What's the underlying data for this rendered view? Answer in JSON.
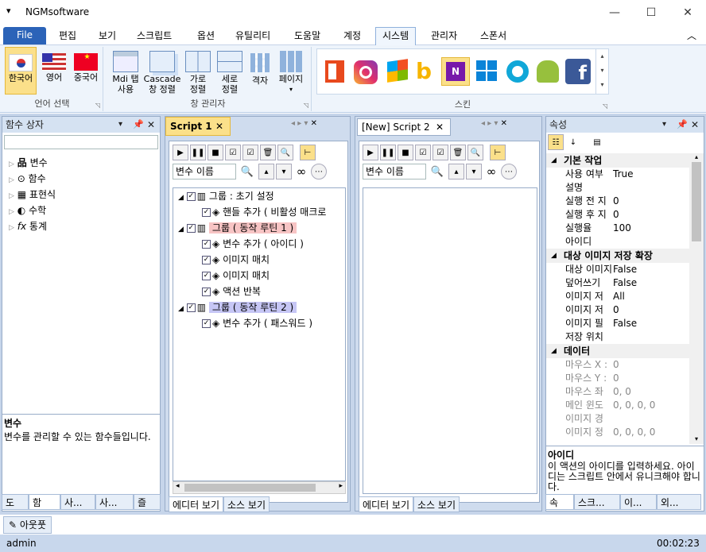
{
  "window": {
    "title": "NGMsoftware"
  },
  "menu": {
    "items": [
      "File",
      "편집",
      "보기",
      "스크립트",
      "옵션",
      "유틸리티",
      "도움말",
      "계정",
      "시스템",
      "관리자",
      "스폰서"
    ]
  },
  "ribbon": {
    "lang_group": {
      "title": "언어 선택",
      "buttons": [
        "한국어",
        "영어",
        "중국어"
      ]
    },
    "window_group": {
      "title": "창 관리자",
      "buttons": [
        [
          "Mdi 탭",
          "사용"
        ],
        [
          "Cascade",
          "창 정렬"
        ],
        [
          "가로",
          "정렬"
        ],
        [
          "세로",
          "정렬"
        ],
        [
          "격자",
          ""
        ],
        [
          "페이지",
          ""
        ]
      ]
    },
    "skin_group": {
      "title": "스킨",
      "skins": [
        "office-icon",
        "instagram-icon",
        "windows-xp-icon",
        "bing-icon",
        "onenote-icon",
        "windows-icon",
        "circle-icon",
        "android-icon",
        "facebook-icon"
      ]
    }
  },
  "function_box": {
    "title": "함수 상자",
    "items": [
      "변수",
      "함수",
      "표현식",
      "수학",
      "통계"
    ],
    "desc_title": "변수",
    "desc_text": "변수를 관리할 수 있는 함수들입니다.",
    "tabs": [
      "도",
      "함",
      "사...",
      "사...",
      "즐"
    ]
  },
  "script1": {
    "tab": "Script 1",
    "search_placeholder": "변수 이름",
    "tree": [
      {
        "label": "그룹 : 초기 설정",
        "level": 0
      },
      {
        "label": "핸들 추가 ( 비활성 매크로",
        "level": 1
      },
      {
        "label": "그룹 ( 동작 루틴 1 )",
        "level": 0,
        "hl": "#f7c4c4"
      },
      {
        "label": "변수 추가 ( 아이디 )",
        "level": 1
      },
      {
        "label": "이미지 매치",
        "level": 1
      },
      {
        "label": "이미지 매치",
        "level": 1
      },
      {
        "label": "액션 반복",
        "level": 1
      },
      {
        "label": "그룹 ( 동작 루틴 2 )",
        "level": 0,
        "hl": "#c6c6f5"
      },
      {
        "label": "변수 추가 ( 패스워드 )",
        "level": 1
      }
    ],
    "bottom_tabs": [
      "에디터 보기",
      "소스 보기"
    ]
  },
  "script2": {
    "tab": "[New] Script 2",
    "search_placeholder": "변수 이름",
    "bottom_tabs": [
      "에디터 보기",
      "소스 보기"
    ]
  },
  "properties": {
    "title": "속성",
    "cats": [
      {
        "name": "기본 작업",
        "rows": [
          [
            "사용 여부",
            "True"
          ],
          [
            "설명",
            ""
          ],
          [
            "실행 전 지",
            "0"
          ],
          [
            "실행 후 지",
            "0"
          ],
          [
            "실행율",
            "100"
          ],
          [
            "아이디",
            ""
          ]
        ]
      },
      {
        "name": "대상 이미지 저장 확장",
        "rows": [
          [
            "대상 이미지",
            "False"
          ],
          [
            "덮어쓰기",
            "False"
          ],
          [
            "이미지 저",
            "All"
          ],
          [
            "이미지 저",
            "0"
          ],
          [
            "이미지 필",
            "False"
          ],
          [
            "저장 위치",
            ""
          ]
        ]
      },
      {
        "name": "데이터",
        "rows": [
          [
            "마우스 X :",
            "0"
          ],
          [
            "마우스 Y :",
            "0"
          ],
          [
            "마우스 좌",
            "0, 0"
          ],
          [
            "메인 윈도",
            "0, 0, 0, 0"
          ],
          [
            "이미지 경",
            ""
          ],
          [
            "이미지 정",
            "0, 0, 0, 0"
          ]
        ]
      }
    ],
    "desc_title": "아이디",
    "desc_text": "이 액션의 아이디를 입력하세요. 아이디는 스크립트 안에서 유니크해야 합니다.",
    "tabs": [
      "속",
      "스크...",
      "이...",
      "외..."
    ]
  },
  "outline_tab": "아웃풋",
  "status": {
    "user": "admin",
    "time": "00:02:23"
  }
}
